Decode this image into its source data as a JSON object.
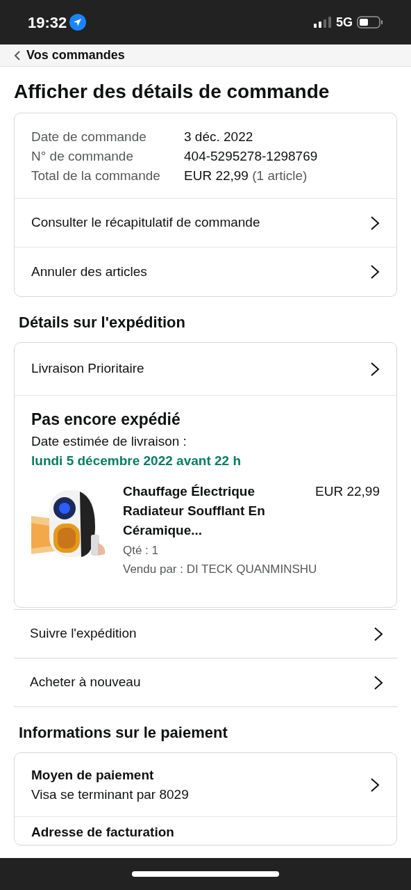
{
  "status_bar": {
    "time": "19:32",
    "network": "5G"
  },
  "nav": {
    "back_label": "Vos commandes"
  },
  "title": "Afficher des détails de commande",
  "order_summary": {
    "fields": [
      {
        "label": "Date de commande",
        "value": "3 déc. 2022"
      },
      {
        "label": "N° de commande",
        "value": "404-5295278-1298769"
      },
      {
        "label": "Total de la commande",
        "value": "EUR 22,99",
        "note": "(1 article)"
      }
    ],
    "links": [
      "Consulter le récapitulatif de commande",
      "Annuler des articles"
    ]
  },
  "shipping": {
    "heading": "Détails sur l'expédition",
    "speed": "Livraison Prioritaire",
    "status": "Pas encore expédié",
    "estimate_label": "Date estimée de livraison :",
    "estimate_date": "lundi 5 décembre 2022 avant 22 h",
    "item": {
      "kind": "picture",
      "title": "Chauffage Électrique Radiateur Soufflant En Céramique...",
      "price": "EUR 22,99",
      "quantity": "Qté : 1",
      "seller": "Vendu par : DI TECK QUANMINSHU"
    }
  },
  "shipment_actions": [
    "Suivre l'expédition",
    "Acheter à nouveau"
  ],
  "payment": {
    "heading": "Informations sur le paiement",
    "rows": [
      {
        "title": "Moyen de paiement",
        "detail": "Visa se terminant par 8029"
      },
      {
        "title": "Adresse de facturation"
      }
    ]
  }
}
